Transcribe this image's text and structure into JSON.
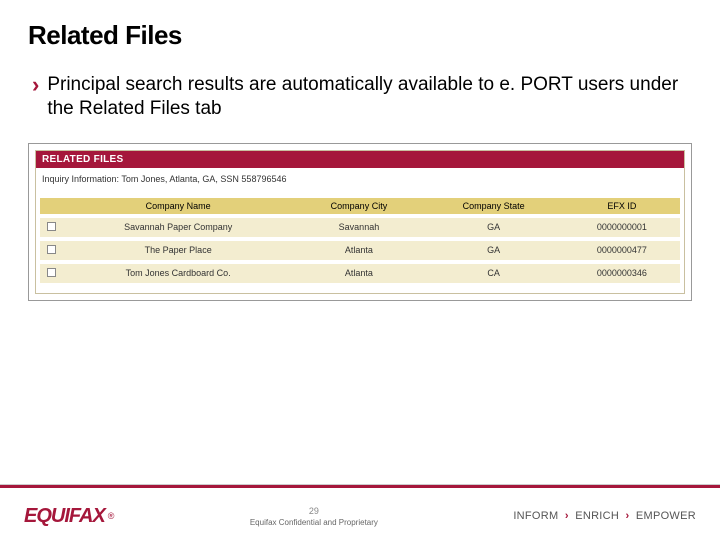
{
  "title": "Related Files",
  "bullet": "Principal search results are automatically available to e. PORT users under the Related Files tab",
  "panel": {
    "header": "RELATED FILES",
    "inquiry": "Inquiry Information: Tom Jones, Atlanta, GA, SSN 558796546",
    "columns": {
      "name": "Company Name",
      "city": "Company City",
      "state": "Company State",
      "efx": "EFX ID"
    },
    "rows": [
      {
        "name": "Savannah Paper Company",
        "city": "Savannah",
        "state": "GA",
        "efx": "0000000001"
      },
      {
        "name": "The Paper Place",
        "city": "Atlanta",
        "state": "GA",
        "efx": "0000000477"
      },
      {
        "name": "Tom Jones Cardboard Co.",
        "city": "Atlanta",
        "state": "CA",
        "efx": "0000000346"
      }
    ]
  },
  "footer": {
    "logo": "EQUIFAX",
    "reg": "®",
    "page": "29",
    "conf": "Equifax Confidential and Proprietary",
    "tag1": "INFORM",
    "tag2": "ENRICH",
    "tag3": "EMPOWER"
  }
}
